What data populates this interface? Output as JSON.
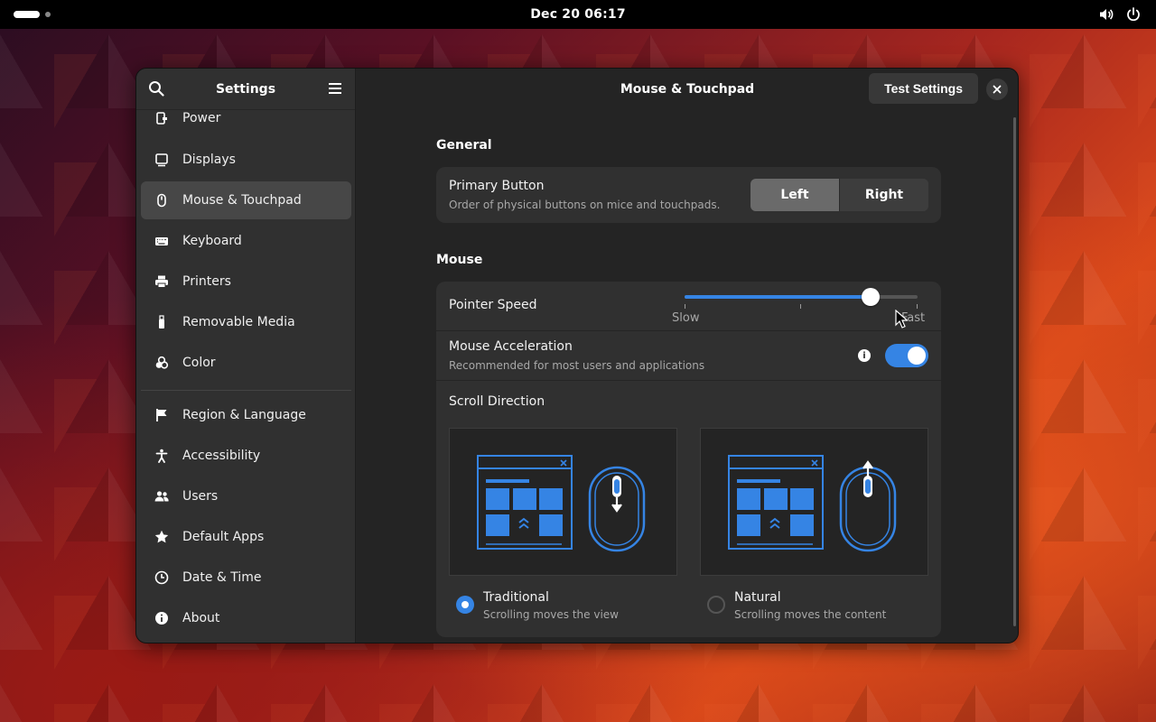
{
  "topbar": {
    "clock": "Dec 20  06:17",
    "icons": [
      "volume-icon",
      "power-icon"
    ]
  },
  "sidebar": {
    "title": "Settings",
    "items": [
      {
        "label": "Power",
        "icon": "power-plug-icon",
        "active": false
      },
      {
        "label": "Displays",
        "icon": "display-icon",
        "active": false
      },
      {
        "label": "Mouse & Touchpad",
        "icon": "mouse-icon",
        "active": true
      },
      {
        "label": "Keyboard",
        "icon": "keyboard-icon",
        "active": false
      },
      {
        "label": "Printers",
        "icon": "printer-icon",
        "active": false
      },
      {
        "label": "Removable Media",
        "icon": "usb-icon",
        "active": false
      },
      {
        "label": "Color",
        "icon": "color-icon",
        "active": false
      },
      {
        "label": "Region & Language",
        "icon": "flag-icon",
        "active": false
      },
      {
        "label": "Accessibility",
        "icon": "accessibility-icon",
        "active": false
      },
      {
        "label": "Users",
        "icon": "users-icon",
        "active": false
      },
      {
        "label": "Default Apps",
        "icon": "star-icon",
        "active": false
      },
      {
        "label": "Date & Time",
        "icon": "clock-icon",
        "active": false
      },
      {
        "label": "About",
        "icon": "info-icon",
        "active": false
      }
    ]
  },
  "header": {
    "title": "Mouse & Touchpad",
    "test_button": "Test Settings"
  },
  "general": {
    "title": "General",
    "primary_button": {
      "label": "Primary Button",
      "subtitle": "Order of physical buttons on mice and touchpads.",
      "options": [
        "Left",
        "Right"
      ],
      "selected": "Left"
    }
  },
  "mouse": {
    "title": "Mouse",
    "pointer_speed": {
      "label": "Pointer Speed",
      "min_label": "Slow",
      "max_label": "Fast",
      "value": 0.8
    },
    "acceleration": {
      "label": "Mouse Acceleration",
      "subtitle": "Recommended for most users and applications",
      "enabled": true
    },
    "scroll_direction": {
      "label": "Scroll Direction",
      "options": [
        {
          "label": "Traditional",
          "subtitle": "Scrolling moves the view",
          "selected": true
        },
        {
          "label": "Natural",
          "subtitle": "Scrolling moves the content",
          "selected": false
        }
      ]
    }
  },
  "colors": {
    "accent": "#3584e4",
    "illustration": "#3584e4"
  }
}
